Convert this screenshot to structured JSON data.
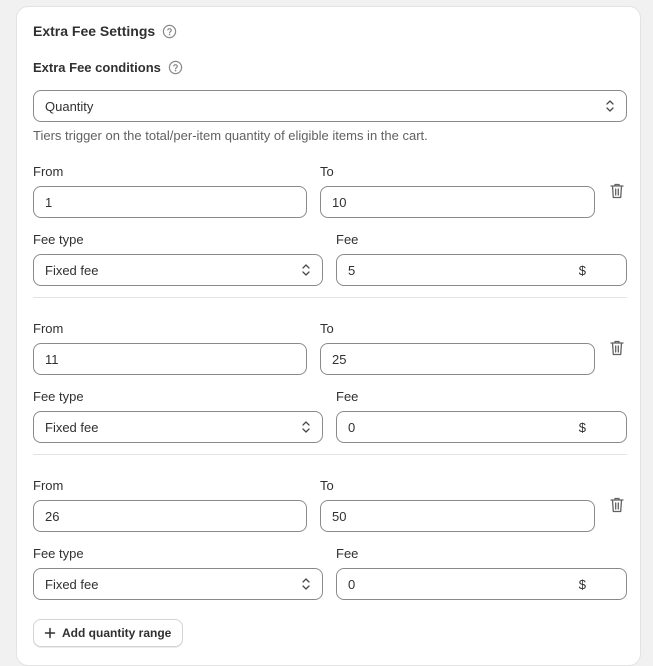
{
  "settings": {
    "title": "Extra Fee Settings",
    "conditions_label": "Extra Fee conditions",
    "condition_value": "Quantity",
    "help_text": "Tiers trigger on the total/per-item quantity of eligible items in the cart."
  },
  "tiers": [
    {
      "from_label": "From",
      "from_value": "1",
      "to_label": "To",
      "to_value": "10",
      "fee_type_label": "Fee type",
      "fee_type_value": "Fixed fee",
      "fee_label": "Fee",
      "fee_value": "5",
      "currency": "$"
    },
    {
      "from_label": "From",
      "from_value": "11",
      "to_label": "To",
      "to_value": "25",
      "fee_type_label": "Fee type",
      "fee_type_value": "Fixed fee",
      "fee_label": "Fee",
      "fee_value": "0",
      "currency": "$"
    },
    {
      "from_label": "From",
      "from_value": "26",
      "to_label": "To",
      "to_value": "50",
      "fee_type_label": "Fee type",
      "fee_type_value": "Fixed fee",
      "fee_label": "Fee",
      "fee_value": "0",
      "currency": "$"
    }
  ],
  "actions": {
    "add_range_label": "Add quantity range"
  },
  "icons": {
    "help": "question-circle-icon",
    "select": "chevron-up-down-icon",
    "delete": "trash-icon",
    "add": "plus-icon"
  }
}
